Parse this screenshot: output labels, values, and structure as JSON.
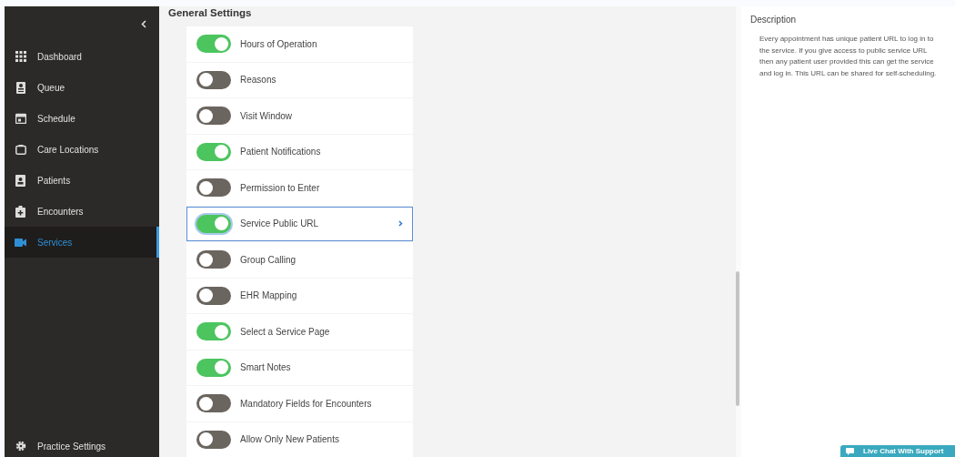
{
  "sidebar": {
    "items": [
      {
        "label": "Dashboard",
        "selected": false
      },
      {
        "label": "Queue",
        "selected": false
      },
      {
        "label": "Schedule",
        "selected": false
      },
      {
        "label": "Care Locations",
        "selected": false
      },
      {
        "label": "Patients",
        "selected": false
      },
      {
        "label": "Encounters",
        "selected": false
      },
      {
        "label": "Services",
        "selected": true
      }
    ],
    "footer_item": {
      "label": "Practice Settings"
    }
  },
  "settings": {
    "title": "General Settings",
    "items": [
      {
        "label": "Hours of Operation",
        "on": true,
        "selected": false
      },
      {
        "label": "Reasons",
        "on": false,
        "selected": false
      },
      {
        "label": "Visit Window",
        "on": false,
        "selected": false
      },
      {
        "label": "Patient Notifications",
        "on": true,
        "selected": false
      },
      {
        "label": "Permission to Enter",
        "on": false,
        "selected": false
      },
      {
        "label": "Service Public URL",
        "on": true,
        "selected": true
      },
      {
        "label": "Group Calling",
        "on": false,
        "selected": false
      },
      {
        "label": "EHR Mapping",
        "on": false,
        "selected": false
      },
      {
        "label": "Select a Service Page",
        "on": true,
        "selected": false
      },
      {
        "label": "Smart Notes",
        "on": true,
        "selected": false
      },
      {
        "label": "Mandatory Fields for Encounters",
        "on": false,
        "selected": false
      },
      {
        "label": "Allow Only New Patients",
        "on": false,
        "selected": false
      }
    ]
  },
  "description": {
    "title": "Description",
    "text": "Every appointment has unique patient URL to log in to the service. If you give access to public service URL then any patient user provided this can get the service and log in. This URL can be shared for self-scheduling."
  },
  "live_chat": {
    "label": "Live Chat With Support"
  }
}
